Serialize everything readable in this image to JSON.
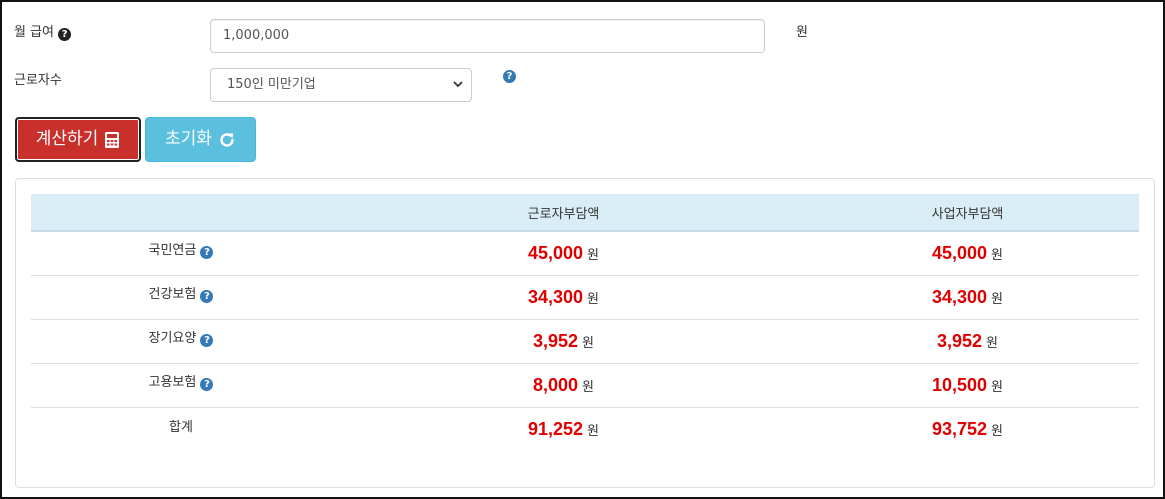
{
  "form": {
    "salary_label": "월 급여",
    "salary_value": "1,000,000",
    "salary_unit": "원",
    "workers_label": "근로자수",
    "workers_selected": "150인 미만기업"
  },
  "buttons": {
    "calculate": "계산하기",
    "reset": "초기화"
  },
  "table": {
    "headers": [
      "",
      "근로자부담액",
      "사업자부담액"
    ],
    "unit": "원",
    "rows": [
      {
        "label": "국민연금",
        "employee": "45,000",
        "employer": "45,000"
      },
      {
        "label": "건강보험",
        "employee": "34,300",
        "employer": "34,300"
      },
      {
        "label": "장기요양",
        "employee": "3,952",
        "employer": "3,952"
      },
      {
        "label": "고용보험",
        "employee": "8,000",
        "employer": "10,500"
      },
      {
        "label": "합계",
        "employee": "91,252",
        "employer": "93,752"
      }
    ]
  },
  "colors": {
    "calc_button": "#c9302c",
    "reset_button": "#5bc0de",
    "header_bg": "#d9edf7",
    "amount": "#e00000",
    "help_icon": "#337ab7"
  }
}
